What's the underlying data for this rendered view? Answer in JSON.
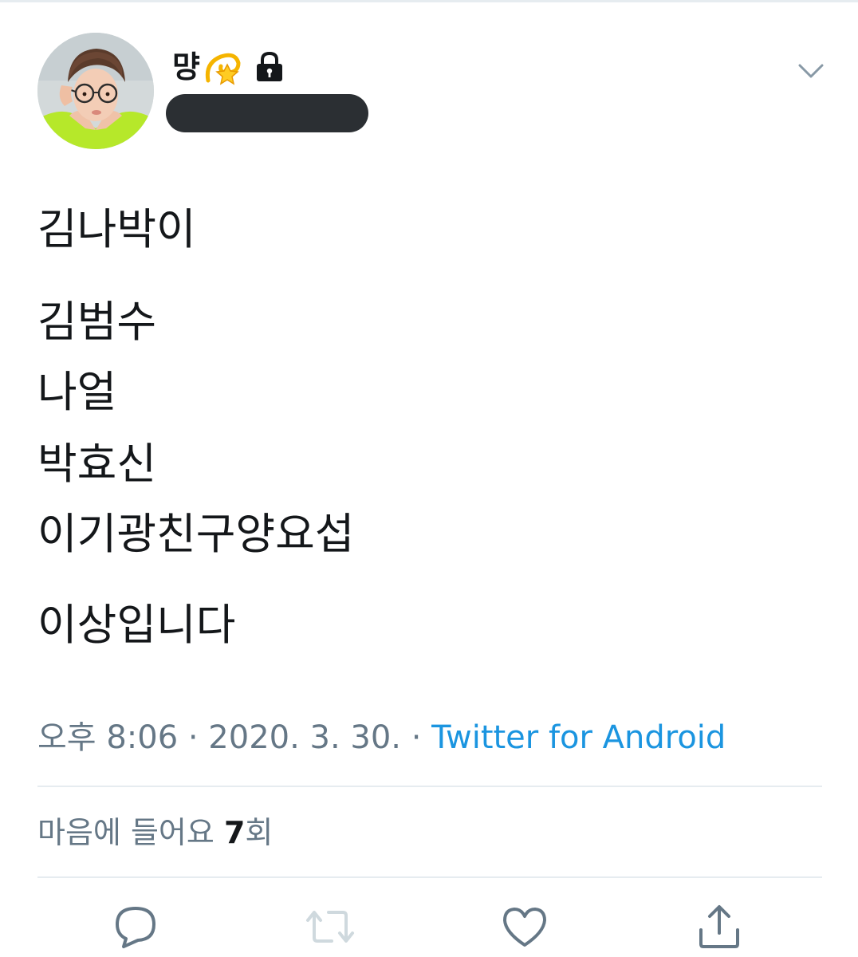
{
  "tweet": {
    "author": {
      "display_name": "먕",
      "name_emoji": "dizzy-emoji",
      "protected_icon": "lock-icon",
      "handle_redacted": true
    },
    "text_lines": [
      "김나박이",
      "김범수",
      "나얼",
      "박효신",
      "이기광친구양요섭",
      "이상입니다"
    ],
    "time": "오후 8:06",
    "date": "2020. 3. 30.",
    "separator": "·",
    "source": "Twitter for Android",
    "likes_label_prefix": "마음에 들어요",
    "likes_count": "7",
    "likes_suffix": "회"
  },
  "actions": [
    {
      "name": "reply",
      "icon": "reply-icon"
    },
    {
      "name": "retweet",
      "icon": "retweet-icon"
    },
    {
      "name": "like",
      "icon": "heart-icon"
    },
    {
      "name": "share",
      "icon": "share-icon"
    }
  ],
  "colors": {
    "link": "#1b95e0",
    "secondary_text": "#657786",
    "divider": "#e6ecf0",
    "redaction": "#2b2f33"
  }
}
